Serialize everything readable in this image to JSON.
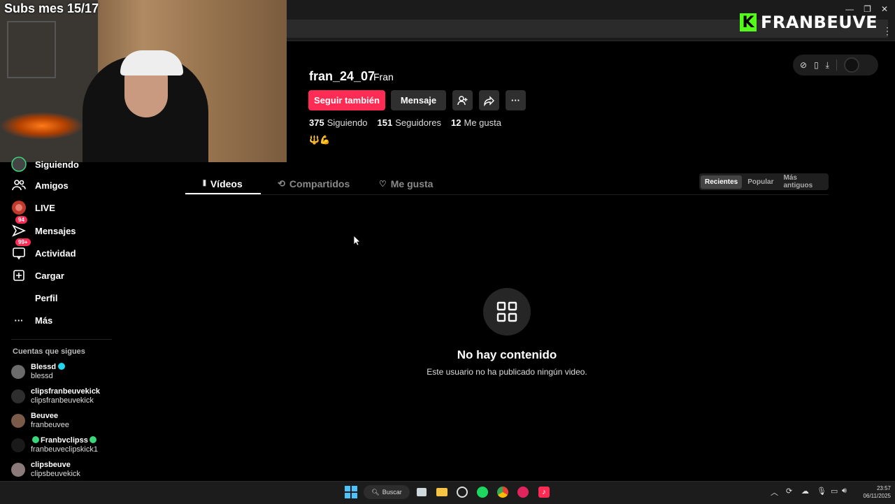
{
  "stream": {
    "subs_goal": "Subs mes 15/17",
    "brand_name": "FRANBEUVE",
    "brand_letter": "K"
  },
  "sidebar": {
    "items": [
      {
        "label": "Siguiendo",
        "icon": "following-avatar-icon"
      },
      {
        "label": "Amigos",
        "icon": "friends-icon"
      },
      {
        "label": "LIVE",
        "icon": "live-icon"
      },
      {
        "label": "Mensajes",
        "icon": "messages-icon",
        "badge": "94"
      },
      {
        "label": "Actividad",
        "icon": "activity-icon",
        "badge": "99+"
      },
      {
        "label": "Cargar",
        "icon": "upload-icon"
      },
      {
        "label": "Perfil",
        "icon": "profile-icon"
      },
      {
        "label": "Más",
        "icon": "more-icon"
      }
    ],
    "following_title": "Cuentas que sigues",
    "accounts": [
      {
        "name": "Blessd",
        "username": "blessd",
        "verified": true
      },
      {
        "name": "clipsfranbeuvekick",
        "username": "clipsfranbeuvekick"
      },
      {
        "name": "Beuvee",
        "username": "franbeuvee"
      },
      {
        "name": "Franbvclipss",
        "username": "franbeuveclipskick1",
        "live_dots": true
      },
      {
        "name": "clipsbeuve",
        "username": "clipsbeuvekick"
      }
    ]
  },
  "profile": {
    "username": "fran_24_07",
    "nickname": "Fran",
    "follow_label": "Seguir también",
    "message_label": "Mensaje",
    "stats": {
      "following_count": "375",
      "following_label": "Siguiendo",
      "followers_count": "151",
      "followers_label": "Seguidores",
      "likes_count": "12",
      "likes_label": "Me gusta"
    },
    "bio_emoji": "🔱💪"
  },
  "tabs": [
    {
      "label": "Vídeos",
      "active": true
    },
    {
      "label": "Compartidos",
      "active": false
    },
    {
      "label": "Me gusta",
      "active": false
    }
  ],
  "sort": {
    "options": [
      "Recientes",
      "Popular",
      "Más antiguos"
    ],
    "selected": "Recientes"
  },
  "empty": {
    "title": "No hay contenido",
    "subtitle": "Este usuario no ha publicado ningún video."
  },
  "taskbar": {
    "search_label": "Buscar",
    "time": "23:57",
    "date": "06/11/2025"
  },
  "colors": {
    "accent": "#fe2c55",
    "background": "#000000",
    "kick_green": "#53fc18"
  }
}
